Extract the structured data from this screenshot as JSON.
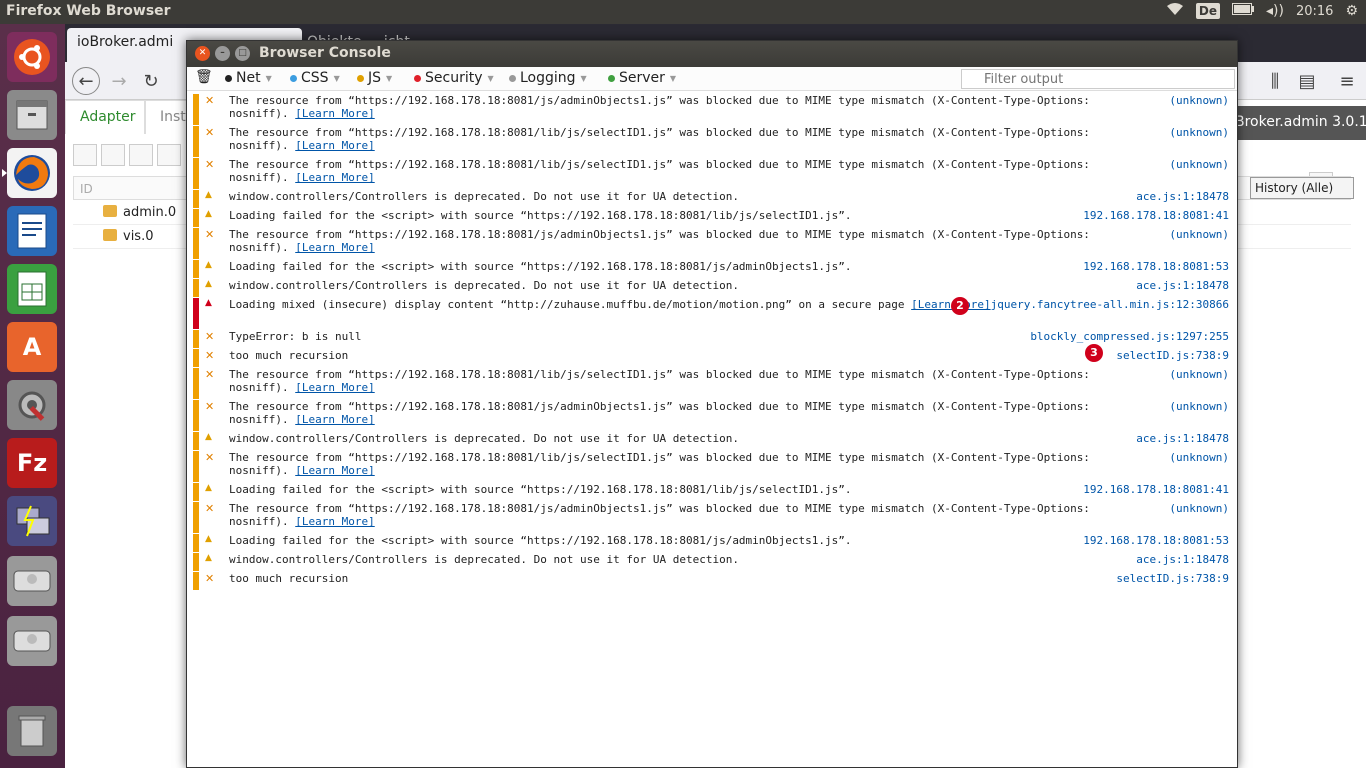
{
  "top_panel": {
    "title": "Firefox Web Browser",
    "keyboard_layout": "De",
    "time": "20:16"
  },
  "firefox": {
    "tabs": [
      {
        "label": "ioBroker.admi"
      },
      {
        "label": "Objekte ... icht ..."
      }
    ],
    "adapter_tabs": [
      {
        "label": "Adapter"
      },
      {
        "label": "Insta"
      }
    ],
    "header_right": "Broker.admin 3.0.1",
    "table_header_id": "ID",
    "rows": [
      {
        "name": "admin.0"
      },
      {
        "name": "vis.0"
      }
    ],
    "history_select": "History (Alle)"
  },
  "console": {
    "title": "Browser Console",
    "filters": [
      {
        "label": "Net",
        "color": "#222222"
      },
      {
        "label": "CSS",
        "color": "#3c9de0"
      },
      {
        "label": "JS",
        "color": "#e0a000"
      },
      {
        "label": "Security",
        "color": "#e0202a"
      },
      {
        "label": "Logging",
        "color": "#999999"
      },
      {
        "label": "Server",
        "color": "#40a040"
      }
    ],
    "filter_placeholder": "Filter output",
    "learn_more": "[Learn More]",
    "markers": [
      {
        "label": "2"
      },
      {
        "label": "3"
      }
    ],
    "messages": [
      {
        "level": "error",
        "text": "The resource from “https://192.168.178.18:8081/js/adminObjects1.js” was blocked due to MIME type mismatch (X-Content-Type-Options: nosniff).",
        "learn": true,
        "source": "(unknown)"
      },
      {
        "level": "error",
        "text": "The resource from “https://192.168.178.18:8081/lib/js/selectID1.js” was blocked due to MIME type mismatch (X-Content-Type-Options: nosniff).",
        "learn": true,
        "source": "(unknown)"
      },
      {
        "level": "error",
        "text": "The resource from “https://192.168.178.18:8081/lib/js/selectID1.js” was blocked due to MIME type mismatch (X-Content-Type-Options: nosniff).",
        "learn": true,
        "source": "(unknown)"
      },
      {
        "level": "warn",
        "text": "window.controllers/Controllers is deprecated. Do not use it for UA detection.",
        "learn": false,
        "source": "ace.js:1:18478"
      },
      {
        "level": "warn",
        "text": "Loading failed for the <script> with source “https://192.168.178.18:8081/lib/js/selectID1.js”.",
        "learn": false,
        "source": "192.168.178.18:8081:41"
      },
      {
        "level": "error",
        "text": "The resource from “https://192.168.178.18:8081/js/adminObjects1.js” was blocked due to MIME type mismatch (X-Content-Type-Options: nosniff).",
        "learn": true,
        "source": "(unknown)"
      },
      {
        "level": "warn",
        "text": "Loading failed for the <script> with source “https://192.168.178.18:8081/js/adminObjects1.js”.",
        "learn": false,
        "source": "192.168.178.18:8081:53"
      },
      {
        "level": "warn",
        "text": "window.controllers/Controllers is deprecated. Do not use it for UA detection.",
        "learn": false,
        "source": "ace.js:1:18478"
      },
      {
        "level": "security",
        "text": "Loading mixed (insecure) display content “http://zuhause.muffbu.de/motion/motion.png” on a secure page",
        "learn": true,
        "source": "jquery.fancytree-all.min.js:12:30866"
      },
      {
        "level": "error",
        "text": "TypeError: b is null",
        "learn": false,
        "source": "blockly_compressed.js:1297:255"
      },
      {
        "level": "error",
        "text": "too much recursion",
        "learn": false,
        "source": "selectID.js:738:9"
      },
      {
        "level": "error",
        "text": "The resource from “https://192.168.178.18:8081/lib/js/selectID1.js” was blocked due to MIME type mismatch (X-Content-Type-Options: nosniff).",
        "learn": true,
        "source": "(unknown)"
      },
      {
        "level": "error",
        "text": "The resource from “https://192.168.178.18:8081/js/adminObjects1.js” was blocked due to MIME type mismatch (X-Content-Type-Options: nosniff).",
        "learn": true,
        "source": "(unknown)"
      },
      {
        "level": "warn",
        "text": "window.controllers/Controllers is deprecated. Do not use it for UA detection.",
        "learn": false,
        "source": "ace.js:1:18478"
      },
      {
        "level": "error",
        "text": "The resource from “https://192.168.178.18:8081/lib/js/selectID1.js” was blocked due to MIME type mismatch (X-Content-Type-Options: nosniff).",
        "learn": true,
        "source": "(unknown)"
      },
      {
        "level": "warn",
        "text": "Loading failed for the <script> with source “https://192.168.178.18:8081/lib/js/selectID1.js”.",
        "learn": false,
        "source": "192.168.178.18:8081:41"
      },
      {
        "level": "error",
        "text": "The resource from “https://192.168.178.18:8081/js/adminObjects1.js” was blocked due to MIME type mismatch (X-Content-Type-Options: nosniff).",
        "learn": true,
        "source": "(unknown)"
      },
      {
        "level": "warn",
        "text": "Loading failed for the <script> with source “https://192.168.178.18:8081/js/adminObjects1.js”.",
        "learn": false,
        "source": "192.168.178.18:8081:53"
      },
      {
        "level": "warn",
        "text": "window.controllers/Controllers is deprecated. Do not use it for UA detection.",
        "learn": false,
        "source": "ace.js:1:18478"
      },
      {
        "level": "error",
        "text": "too much recursion",
        "learn": false,
        "source": "selectID.js:738:9"
      }
    ]
  }
}
